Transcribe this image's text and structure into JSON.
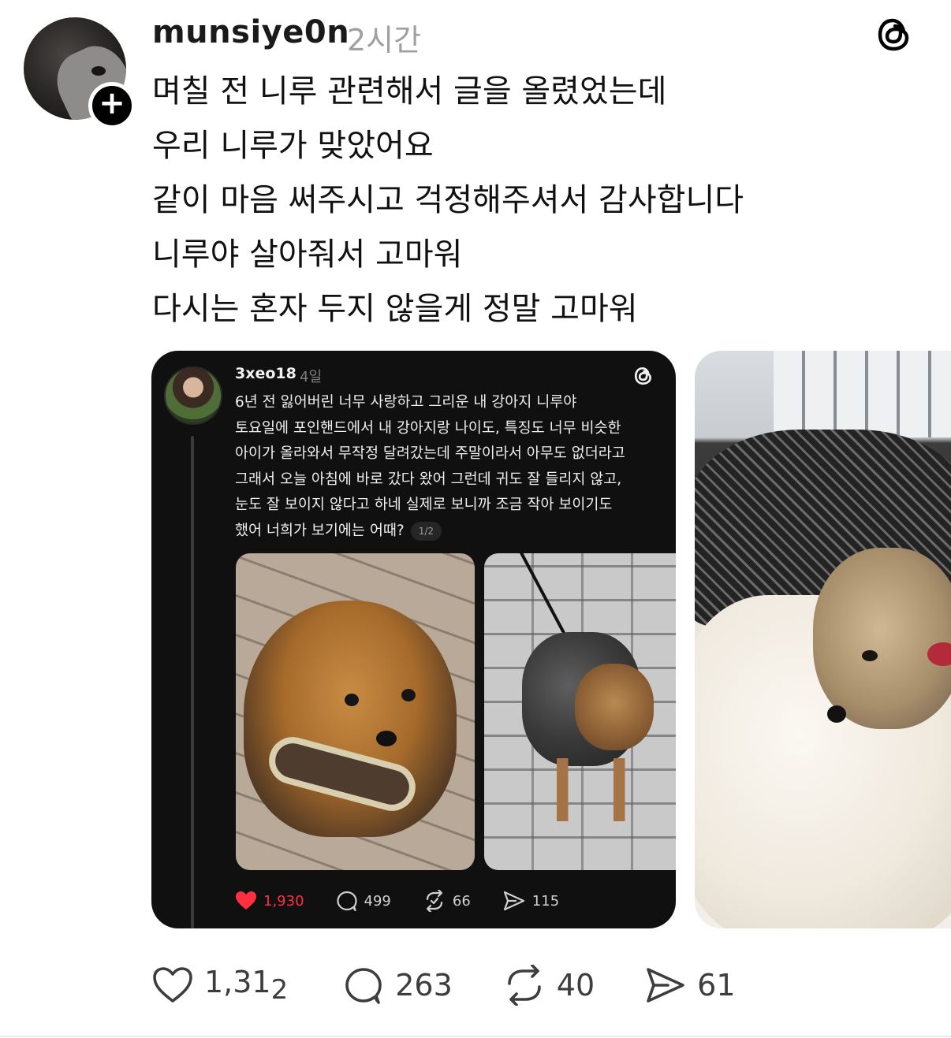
{
  "post": {
    "username": "munsiye0n",
    "time": "2시간",
    "lines": [
      "며칠 전 니루 관련해서 글을 올렸었는데",
      "우리 니루가 맞았어요",
      "같이 마음 써주시고 걱정해주셔서 감사합니다",
      "니루야 살아줘서 고마워",
      "다시는 혼자 두지 않을게 정말 고마워"
    ],
    "stats": {
      "likes": "1,31",
      "likes_tail": "2",
      "replies": "263",
      "reposts": "40",
      "shares": "61"
    }
  },
  "embedded": {
    "username": "3xeo18",
    "time": "4일",
    "lines": [
      "6년 전 잃어버린 너무 사랑하고 그리운 내 강아지 니루야",
      "토요일에 포인핸드에서 내 강아지랑 나이도, 특징도 너무 비슷한",
      "아이가 올라와서 무작정 달려갔는데 주말이라서 아무도 없더라고",
      "그래서 오늘 아침에 바로 갔다 왔어 그런데 귀도 잘 들리지 않고,",
      "눈도 잘 보이지 않다고 하네 실제로 보니까 조금 작아 보이기도",
      "했어 너희가 보기에는 어때?"
    ],
    "page_indicator": "1/2",
    "stats": {
      "likes": "1,930",
      "replies": "499",
      "reposts": "66",
      "shares": "115"
    }
  },
  "colors": {
    "like_red": "#ff3040",
    "card_bg": "#101010"
  },
  "icons": [
    "threads-logo-icon",
    "plus-icon",
    "heart-icon",
    "comment-icon",
    "repost-icon",
    "share-icon"
  ]
}
